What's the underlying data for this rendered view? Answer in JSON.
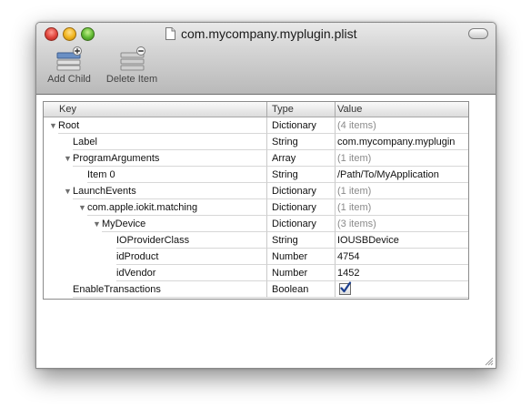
{
  "window": {
    "title": "com.mycompany.myplugin.plist"
  },
  "toolbar": {
    "add_child_label": "Add Child",
    "delete_item_label": "Delete Item"
  },
  "table": {
    "headers": {
      "key": "Key",
      "type": "Type",
      "value": "Value"
    },
    "rows": [
      {
        "key": "Root",
        "indent": 0,
        "expander": "open",
        "type": "Dictionary",
        "value": "(4 items)",
        "dim": true
      },
      {
        "key": "Label",
        "indent": 1,
        "expander": "none",
        "type": "String",
        "value": "com.mycompany.myplugin",
        "dim": false
      },
      {
        "key": "ProgramArguments",
        "indent": 1,
        "expander": "open",
        "type": "Array",
        "value": "(1 item)",
        "dim": true
      },
      {
        "key": "Item 0",
        "indent": 2,
        "expander": "none",
        "type": "String",
        "value": "/Path/To/MyApplication",
        "dim": false
      },
      {
        "key": "LaunchEvents",
        "indent": 1,
        "expander": "open",
        "type": "Dictionary",
        "value": "(1 item)",
        "dim": true
      },
      {
        "key": "com.apple.iokit.matching",
        "indent": 2,
        "expander": "open",
        "type": "Dictionary",
        "value": "(1 item)",
        "dim": true
      },
      {
        "key": "MyDevice",
        "indent": 3,
        "expander": "open",
        "type": "Dictionary",
        "value": "(3 items)",
        "dim": true
      },
      {
        "key": "IOProviderClass",
        "indent": 4,
        "expander": "none",
        "type": "String",
        "value": "IOUSBDevice",
        "dim": false
      },
      {
        "key": "idProduct",
        "indent": 4,
        "expander": "none",
        "type": "Number",
        "value": "4754",
        "dim": false
      },
      {
        "key": "idVendor",
        "indent": 4,
        "expander": "none",
        "type": "Number",
        "value": "1452",
        "dim": false
      },
      {
        "key": "EnableTransactions",
        "indent": 1,
        "expander": "none",
        "type": "Boolean",
        "value": "",
        "checkbox": true,
        "checked": true,
        "dim": false
      }
    ]
  }
}
